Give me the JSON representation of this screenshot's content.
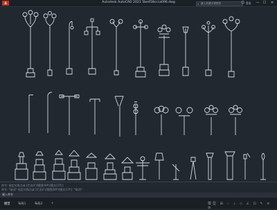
{
  "window": {
    "app_badge": "A",
    "title": "Autodesk AutoCAD 2021    5be458ccca096.dwg",
    "search_placeholder": "键入关键字或短语",
    "user_label": "登录",
    "controls": [
      "—",
      "☐",
      "✕"
    ]
  },
  "command": {
    "history_1": "命令: 指定对角点或 [栏选(F)/圈围(WP)/圈交(CP)]:",
    "history_2": "命令: *取消*  指定对角点或 [栏选(F)/圈围(WP)/圈交(CP)]: *取消*",
    "prompt": "键入命令"
  },
  "layout_tabs": [
    "模型",
    "布局1",
    "布局2",
    "+"
  ],
  "status": {
    "icons": "模型 ⊞ ∷ ⊥ ◇ ∠ ⊡ ✎ ≡ ⚙"
  },
  "drawing": {
    "stroke_color": "#d6dbe0",
    "background_color": "#212830",
    "rows": 3
  }
}
